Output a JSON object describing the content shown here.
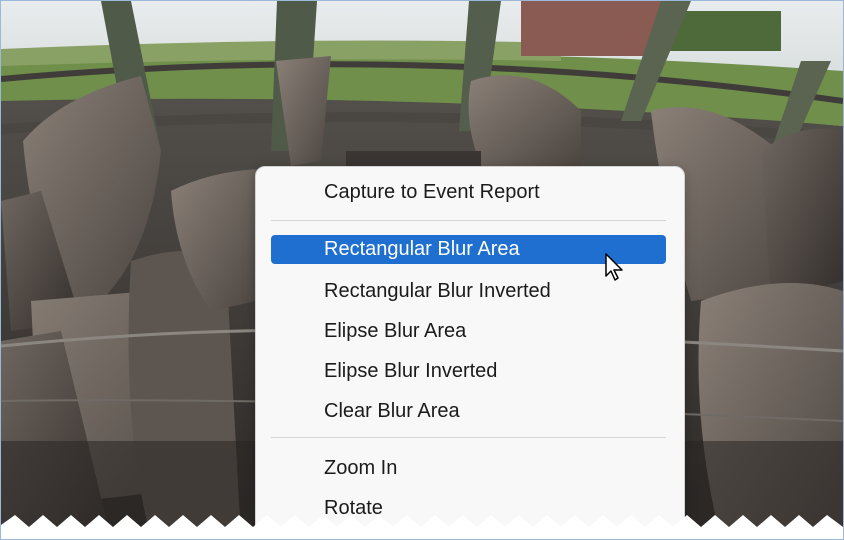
{
  "context_menu": {
    "items": [
      {
        "label": "Capture to Event Report",
        "state": "normal"
      },
      {
        "label": "Rectangular Blur Area",
        "state": "highlighted"
      },
      {
        "label": "Rectangular Blur Inverted",
        "state": "normal"
      },
      {
        "label": "Elipse Blur Area",
        "state": "normal"
      },
      {
        "label": "Elipse Blur Inverted",
        "state": "normal"
      },
      {
        "label": "Clear Blur Area",
        "state": "normal"
      },
      {
        "label": "Zoom In",
        "state": "normal"
      },
      {
        "label": "Rotate",
        "state": "normal"
      }
    ]
  },
  "colors": {
    "highlight": "#1f6fd0",
    "menu_background": "#f8f8f8"
  },
  "icons": {
    "pointer": "arrow-cursor-icon"
  }
}
